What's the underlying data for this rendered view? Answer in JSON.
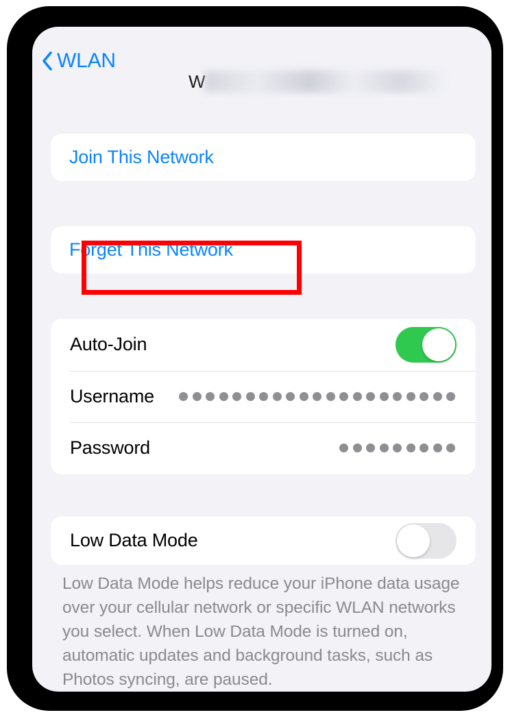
{
  "screen": {
    "background_color": "#f2f2f7",
    "bezel_color": "#000000"
  },
  "navbar": {
    "back_label": "WLAN",
    "back_icon": "chevron-left-icon",
    "title_visible_prefix": "W",
    "title_redacted_text": "REDACTED NETWORK NAME",
    "title_is_blurred": true
  },
  "actions": {
    "join_label": "Join This Network",
    "forget_label": "Forget This Network",
    "link_color": "#0a84ff"
  },
  "settings": {
    "auto_join": {
      "label": "Auto-Join",
      "state": "on",
      "on_color": "#30c94f"
    },
    "username": {
      "label": "Username",
      "masked": true,
      "dot_count": 21,
      "dot_color": "#8e8e93"
    },
    "password": {
      "label": "Password",
      "masked": true,
      "dot_count": 9,
      "dot_color": "#8e8e93"
    },
    "low_data_mode": {
      "label": "Low Data Mode",
      "state": "off",
      "off_color": "#e6e6e9"
    }
  },
  "footer": {
    "description": "Low Data Mode helps reduce your iPhone data usage over your cellular network or specific WLAN networks you select. When Low Data Mode is turned on, automatic updates and background tasks, such as Photos syncing, are paused."
  },
  "annotation": {
    "type": "highlight-rectangle",
    "color": "#fe0000",
    "targets": "forget-this-network-button"
  }
}
